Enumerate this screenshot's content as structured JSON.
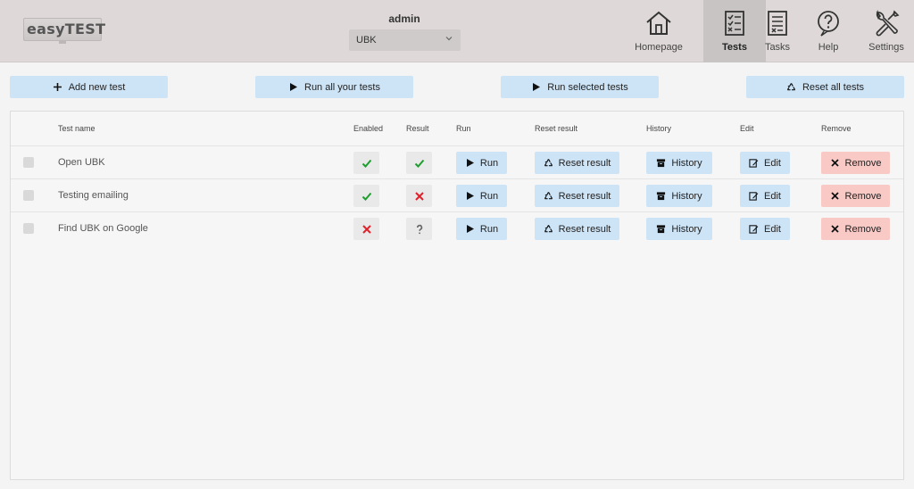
{
  "header": {
    "logo_text": "easyTEST",
    "user": "admin",
    "project_selected": "UBK",
    "nav": [
      {
        "label": "Homepage",
        "icon": "home-icon",
        "active": false
      },
      {
        "label": "Tests",
        "icon": "checklist-icon",
        "active": true
      },
      {
        "label": "Tasks",
        "icon": "tasks-icon",
        "active": false
      },
      {
        "label": "Help",
        "icon": "help-icon",
        "active": false
      },
      {
        "label": "Settings",
        "icon": "settings-icon",
        "active": false
      }
    ]
  },
  "toolbar": {
    "add_new_test": "Add new test",
    "run_all": "Run all your tests",
    "run_selected": "Run selected tests",
    "reset_all": "Reset all tests"
  },
  "table": {
    "headers": {
      "test_name": "Test name",
      "enabled": "Enabled",
      "result": "Result",
      "run": "Run",
      "reset_result": "Reset result",
      "history": "History",
      "edit": "Edit",
      "remove": "Remove"
    },
    "rows": [
      {
        "name": "Open UBK",
        "enabled": "check",
        "result": "check"
      },
      {
        "name": "Testing emailing",
        "enabled": "check",
        "result": "cross"
      },
      {
        "name": "Find UBK on Google",
        "enabled": "cross",
        "result": "question"
      }
    ],
    "actions": {
      "run": "Run",
      "reset": "Reset result",
      "history": "History",
      "edit": "Edit",
      "remove": "Remove"
    }
  },
  "colors": {
    "header_bg": "#ded9d8",
    "button_blue": "#cde4f7",
    "button_red": "#f9c9c6",
    "check_green": "#1f9d2e",
    "cross_red": "#e0202a"
  }
}
